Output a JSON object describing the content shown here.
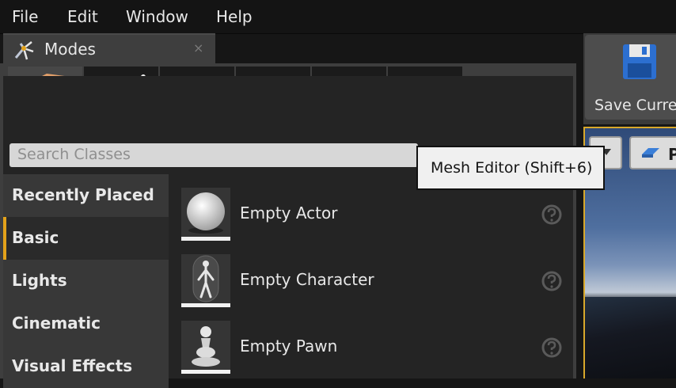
{
  "menu": {
    "file": "File",
    "edit": "Edit",
    "window": "Window",
    "help": "Help"
  },
  "modes_tab": {
    "label": "Modes",
    "close": "×"
  },
  "mode_buttons": [
    {
      "name": "place-mode",
      "icon": "place-mode-icon",
      "active": true
    },
    {
      "name": "paint-mode",
      "icon": "paint-brush-icon",
      "active": false
    },
    {
      "name": "landscape-mode",
      "icon": "landscape-mountain-icon",
      "active": false
    },
    {
      "name": "foliage-mode",
      "icon": "foliage-leaf-icon",
      "active": false
    },
    {
      "name": "mesh-editor-mode",
      "icon": "mesh-cube-icon",
      "active": false
    },
    {
      "name": "geometry-mode",
      "icon": "geometry-sphere-icon",
      "active": false
    }
  ],
  "search": {
    "placeholder": "Search Classes"
  },
  "tooltip": {
    "text": "Mesh Editor (Shift+6)"
  },
  "categories": [
    {
      "label": "Recently Placed",
      "active": false
    },
    {
      "label": "Basic",
      "active": true
    },
    {
      "label": "Lights",
      "active": false
    },
    {
      "label": "Cinematic",
      "active": false
    },
    {
      "label": "Visual Effects",
      "active": false
    }
  ],
  "items": [
    {
      "label": "Empty Actor",
      "thumb": "sphere-icon"
    },
    {
      "label": "Empty Character",
      "thumb": "character-icon"
    },
    {
      "label": "Empty Pawn",
      "thumb": "pawn-icon"
    }
  ],
  "toolbar": {
    "save_label": "Save Curre"
  },
  "viewport": {
    "button_label": "P"
  },
  "colors": {
    "accent": "#e3a21a",
    "panel": "#3e3e3e",
    "tooltip_bg": "#f0f0f0"
  }
}
